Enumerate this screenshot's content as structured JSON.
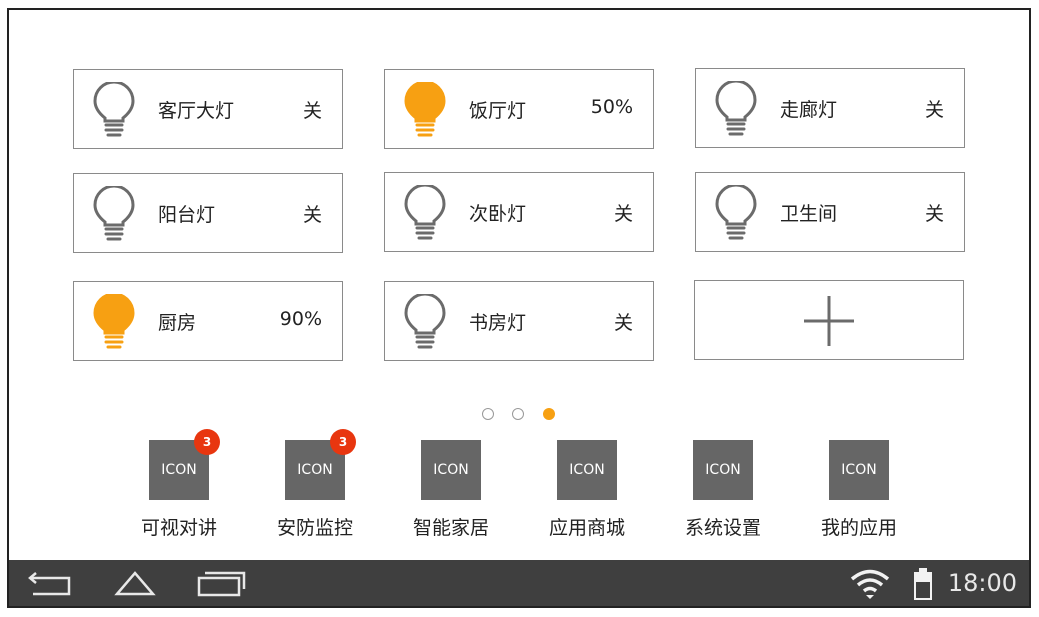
{
  "lights": [
    {
      "name": "客厅大灯",
      "state": "关",
      "on": false
    },
    {
      "name": "饭厅灯",
      "state": "50%",
      "on": true
    },
    {
      "name": "走廊灯",
      "state": "关",
      "on": false
    },
    {
      "name": "阳台灯",
      "state": "关",
      "on": false
    },
    {
      "name": "次卧灯",
      "state": "关",
      "on": false
    },
    {
      "name": "卫生间",
      "state": "关",
      "on": false
    },
    {
      "name": "厨房",
      "state": "90%",
      "on": true
    },
    {
      "name": "书房灯",
      "state": "关",
      "on": false
    }
  ],
  "add_tile": {
    "icon": "plus-icon"
  },
  "pager": {
    "pages": 3,
    "current": 3
  },
  "apps": [
    {
      "icon_text": "ICON",
      "label": "可视对讲",
      "badge": "3"
    },
    {
      "icon_text": "ICON",
      "label": "安防监控",
      "badge": "3"
    },
    {
      "icon_text": "ICON",
      "label": "智能家居",
      "badge": null
    },
    {
      "icon_text": "ICON",
      "label": "应用商城",
      "badge": null
    },
    {
      "icon_text": "ICON",
      "label": "系统设置",
      "badge": null
    },
    {
      "icon_text": "ICON",
      "label": "我的应用",
      "badge": null
    }
  ],
  "status_bar": {
    "time": "18:00",
    "icons": [
      "back-icon",
      "home-icon",
      "recent-apps-icon",
      "wifi-icon",
      "battery-icon"
    ]
  },
  "colors": {
    "bulb_on": "#f7a012",
    "bulb_off": "#6b6b6b",
    "badge": "#e8360f",
    "navbar": "#3f3f3f",
    "icon_placeholder": "#666666"
  }
}
